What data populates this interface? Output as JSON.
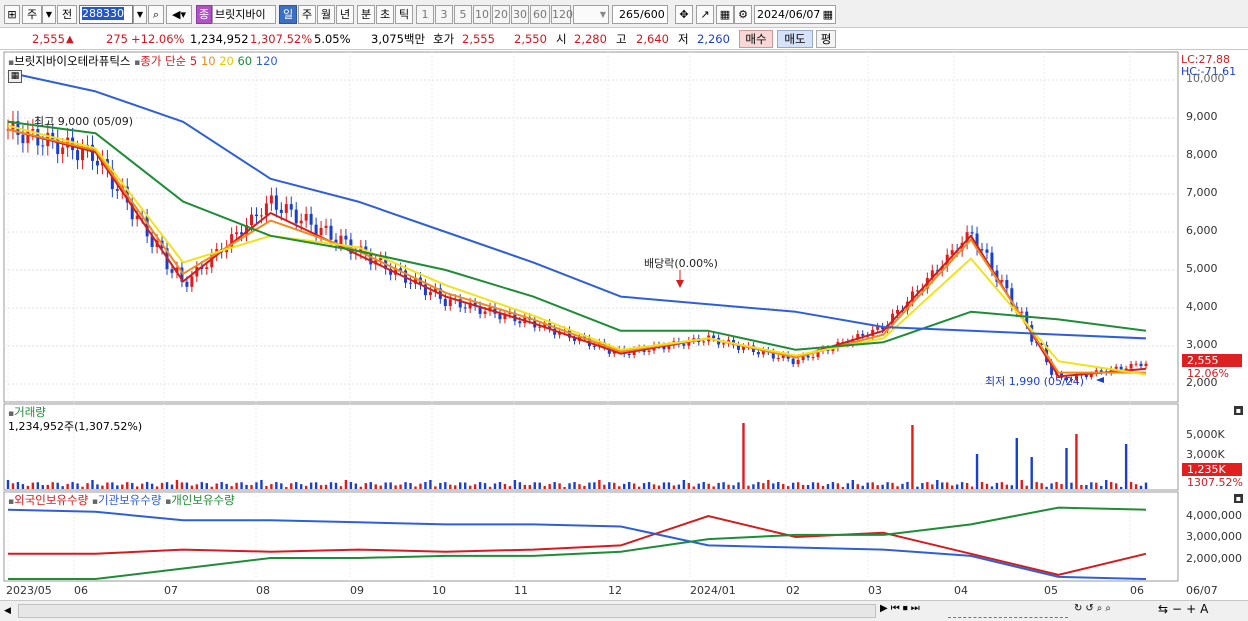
{
  "toolbar": {
    "period_main": "주",
    "period_prev": "전",
    "code": "288330",
    "stock_name": "브릿지바이",
    "periods": [
      "일",
      "주",
      "월",
      "년",
      "분",
      "초",
      "틱"
    ],
    "intervals": [
      "1",
      "3",
      "5",
      "10",
      "20",
      "30",
      "60",
      "120"
    ],
    "count": "265",
    "count_total": "/600",
    "date": "2024/06/07"
  },
  "quote": {
    "price": "2,555",
    "change": "275",
    "change_pct": "+12.06%",
    "volume": "1,234,952",
    "vol_ratio": "1,307.52%",
    "turnover_rate": "5.05%",
    "amount": "3,075백만",
    "ask_label": "호가",
    "ask1": "2,555",
    "ask2": "2,550",
    "open_label": "시",
    "open": "2,280",
    "high_label": "고",
    "high": "2,640",
    "low_label": "저",
    "low": "2,260",
    "buy": "매수",
    "sell": "매도",
    "avg": "평"
  },
  "price_panel": {
    "stock_label": "브릿지바이오테라퓨틱스",
    "ma_label": "종가 단순",
    "ma_periods": [
      "5",
      "10",
      "20",
      "60",
      "120"
    ],
    "ma_colors": [
      "#d41c1c",
      "#f08a1c",
      "#f2e21a",
      "#1f8c36",
      "#2f5fd8"
    ],
    "lc": "LC:27.88",
    "hc": "HC:-71.61",
    "y_ticks": [
      "10,000",
      "9,000",
      "8,000",
      "7,000",
      "6,000",
      "5,000",
      "4,000",
      "3,000",
      "2,000"
    ],
    "high_note": "최고 9,000 (05/09)",
    "low_note": "최저 1,990 (05/24)",
    "dividend_note": "배당락(0.00%)",
    "current_tag": "2,555",
    "current_pct": "12.06%"
  },
  "volume_panel": {
    "title": "거래량",
    "value": "1,234,952주(1,307.52%)",
    "y_ticks": [
      "5,000K",
      "3,000K"
    ],
    "current_tag": "1,235K",
    "current_pct": "1307.52%"
  },
  "holding_panel": {
    "series": [
      "외국인보유수량",
      "기관보유수량",
      "개인보유수량"
    ],
    "colors": [
      "#d41c1c",
      "#2f5fd8",
      "#1f8c36"
    ],
    "y_ticks": [
      "4,000,000",
      "3,000,000",
      "2,000,000"
    ]
  },
  "x_axis": [
    "2023/05",
    "06",
    "07",
    "08",
    "09",
    "10",
    "11",
    "12",
    "2024/01",
    "02",
    "03",
    "04",
    "05",
    "06",
    "06/07"
  ],
  "chart_data": {
    "type": "line",
    "title": "브릿지바이오테라퓨틱스",
    "x": [
      "2023/05",
      "06",
      "07",
      "08",
      "09",
      "10",
      "11",
      "12",
      "2024/01",
      "02",
      "03",
      "04",
      "05",
      "06"
    ],
    "series": [
      {
        "name": "종가",
        "values": [
          8700,
          8000,
          4600,
          6800,
          5500,
          4200,
          3600,
          2800,
          3200,
          2600,
          3500,
          6000,
          2100,
          2555
        ]
      },
      {
        "name": "5",
        "values": [
          8700,
          8100,
          4700,
          6500,
          5400,
          4300,
          3600,
          2800,
          3200,
          2700,
          3400,
          5900,
          2200,
          2400
        ]
      },
      {
        "name": "10",
        "values": [
          8700,
          8150,
          4900,
          6300,
          5500,
          4400,
          3700,
          2850,
          3200,
          2700,
          3300,
          5800,
          2300,
          2300
        ]
      },
      {
        "name": "20",
        "values": [
          8800,
          8200,
          5200,
          5900,
          5600,
          4600,
          3800,
          2900,
          3200,
          2750,
          3200,
          5300,
          2600,
          2250
        ]
      },
      {
        "name": "60",
        "values": [
          8900,
          8600,
          6800,
          5900,
          5500,
          5000,
          4300,
          3400,
          3400,
          2900,
          3100,
          3900,
          3700,
          3400
        ]
      },
      {
        "name": "120",
        "values": [
          10200,
          9700,
          8900,
          7400,
          6800,
          6000,
          5200,
          4300,
          4100,
          3900,
          3500,
          3400,
          3300,
          3200
        ]
      }
    ],
    "annotations": [
      "최고 9,000 (05/09)",
      "최저 1,990 (05/24)",
      "배당락(0.00%)"
    ],
    "ylim": [
      1600,
      10400
    ]
  }
}
